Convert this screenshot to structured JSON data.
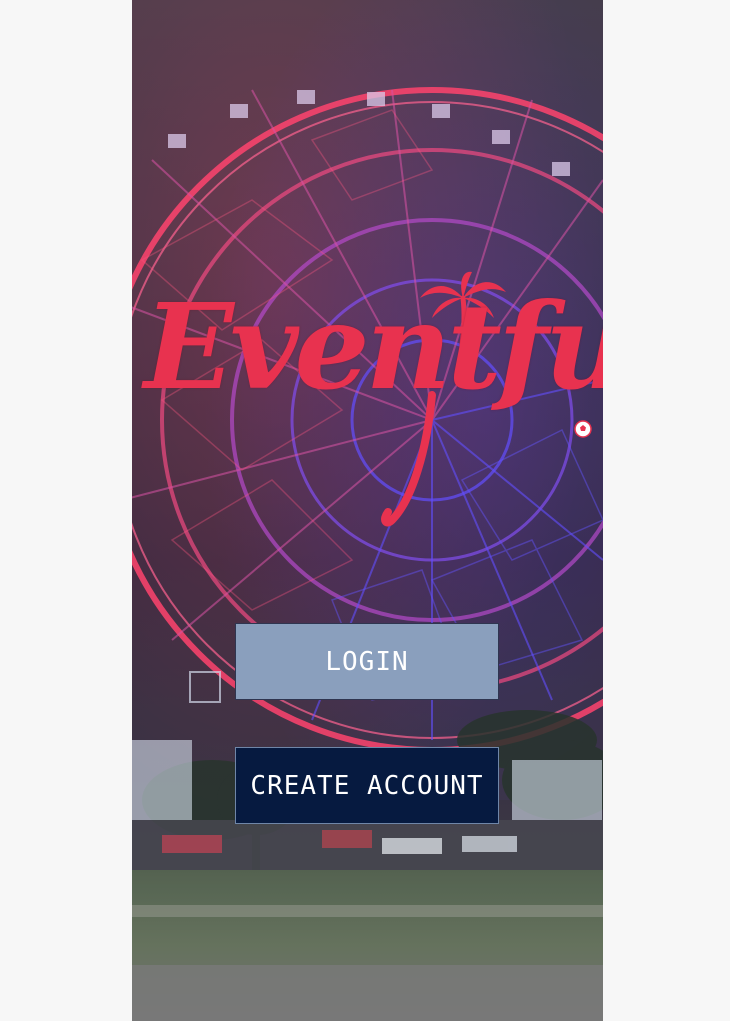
{
  "app": {
    "logo_text": "Eventful"
  },
  "buttons": {
    "login_label": "LOGIN",
    "create_account_label": "CREATE ACCOUNT"
  },
  "colors": {
    "brand_red": "#e8324f",
    "login_bg": "#8a9fbd",
    "create_bg": "#061a40",
    "background_night": "#2b2230",
    "wheel_red": "#ff2d55",
    "wheel_blue": "#4b39ff"
  },
  "icons": {
    "palm": "palm-tree-icon",
    "ball": "soccer-ball-icon"
  }
}
